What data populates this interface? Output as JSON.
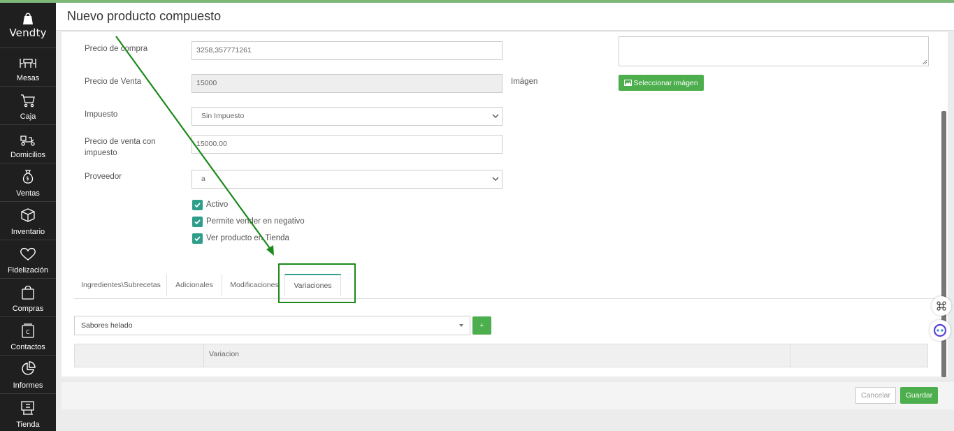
{
  "app": {
    "brand": "Vendty"
  },
  "sidebar": {
    "items": [
      {
        "label": "Mesas",
        "icon": "tables-icon"
      },
      {
        "label": "Caja",
        "icon": "cart-icon"
      },
      {
        "label": "Domicilios",
        "icon": "delivery-icon"
      },
      {
        "label": "Ventas",
        "icon": "money-bag-icon"
      },
      {
        "label": "Inventario",
        "icon": "box-icon"
      },
      {
        "label": "Fidelización",
        "icon": "heart-icon"
      },
      {
        "label": "Compras",
        "icon": "shopping-bag-icon"
      },
      {
        "label": "Contactos",
        "icon": "contacts-icon"
      },
      {
        "label": "Informes",
        "icon": "pie-chart-icon"
      },
      {
        "label": "Tienda",
        "icon": "store-icon"
      }
    ]
  },
  "header": {
    "title": "Nuevo producto compuesto"
  },
  "form": {
    "precio_compra": {
      "label": "Precio de compra",
      "value": "3258,357771261"
    },
    "precio_venta": {
      "label": "Precio de Venta",
      "value": "15000"
    },
    "impuesto": {
      "label": "Impuesto",
      "value": "Sin Impuesto"
    },
    "precio_con_impuesto": {
      "label_line1": "Precio de venta con",
      "label_line2": "impuesto",
      "value": "15000.00"
    },
    "proveedor": {
      "label": "Proveedor",
      "value": "a"
    },
    "imagen": {
      "label": "Imágen",
      "button": "Seleccionar imágen"
    },
    "checks": {
      "activo": "Activo",
      "negativo": "Permite vender en negativo",
      "tienda": "Ver producto en Tienda"
    }
  },
  "tabs": [
    "Ingredientes\\Subrecetas",
    "Adicionales",
    "Modificaciones",
    "Variaciones"
  ],
  "variaciones": {
    "select_value": "Sabores helado",
    "add_button": "+",
    "table_header": "Variacion"
  },
  "footer": {
    "cancel": "Cancelar",
    "save": "Guardar"
  },
  "colors": {
    "accent_green": "#4cae4c",
    "check_teal": "#2e9e8a",
    "annotation_green": "#1b8a1b",
    "sidebar_bg": "#1f1f1f"
  }
}
